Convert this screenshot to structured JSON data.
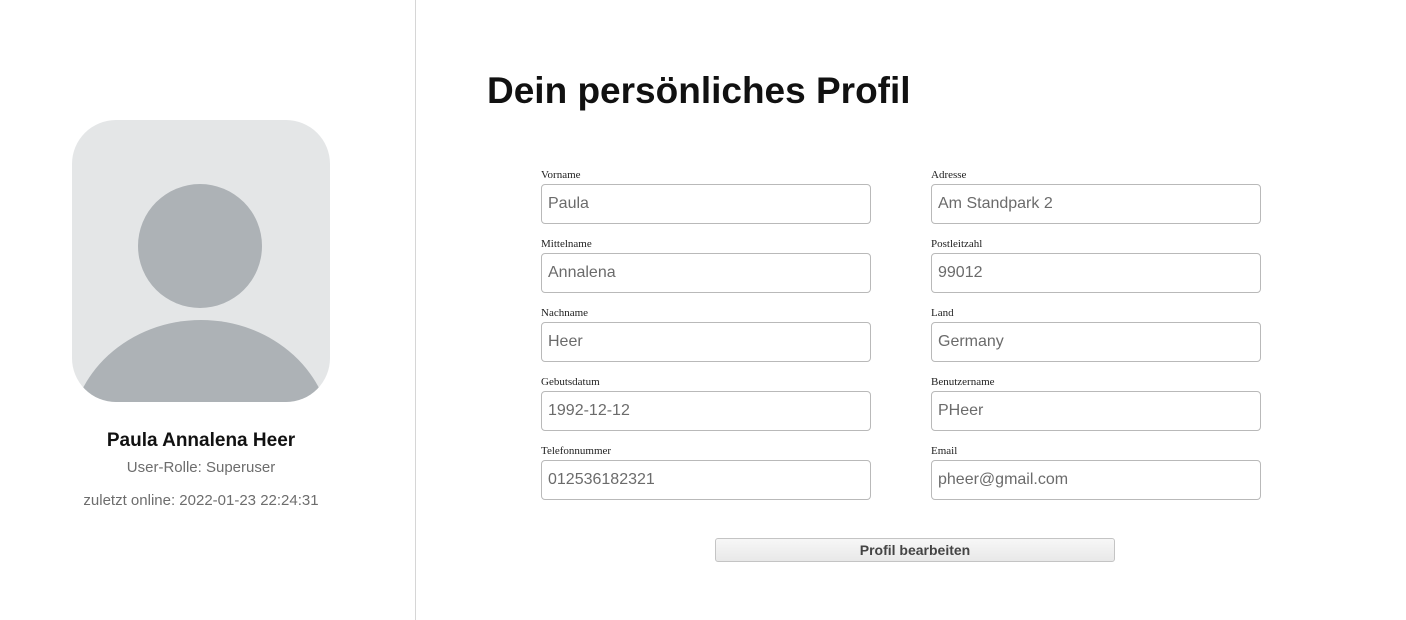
{
  "profile": {
    "name": "Paula Annalena Heer",
    "role": "User-Rolle: Superuser",
    "last_online": "zuletzt online: 2022-01-23 22:24:31"
  },
  "main": {
    "title": "Dein persönliches Profil",
    "edit_button": "Profil bearbeiten"
  },
  "form": {
    "left": [
      {
        "label": "Vorname",
        "value": "Paula"
      },
      {
        "label": "Mittelname",
        "value": "Annalena"
      },
      {
        "label": "Nachname",
        "value": "Heer"
      },
      {
        "label": "Gebutsdatum",
        "value": "1992-12-12"
      },
      {
        "label": "Telefonnummer",
        "value": "012536182321"
      }
    ],
    "right": [
      {
        "label": "Adresse",
        "value": "Am Standpark 2"
      },
      {
        "label": "Postleitzahl",
        "value": "99012"
      },
      {
        "label": "Land",
        "value": "Germany"
      },
      {
        "label": "Benutzername",
        "value": "PHeer"
      },
      {
        "label": "Email",
        "value": "pheer@gmail.com"
      }
    ]
  },
  "colors": {
    "avatar_background": "#e4e6e7",
    "avatar_silhouette": "#adb2b6",
    "divider": "#d6d6d6"
  }
}
